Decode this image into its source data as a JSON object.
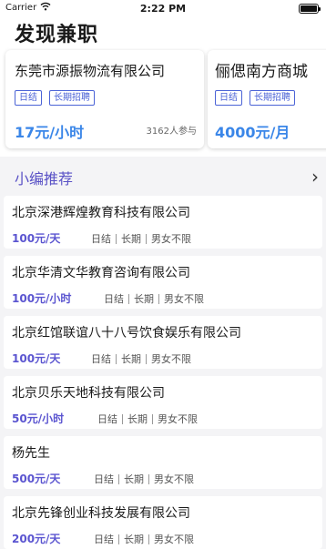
{
  "status_bar": {
    "carrier": "Carrier",
    "time": "2:22 PM"
  },
  "header": {
    "title": "发现兼职"
  },
  "featured": [
    {
      "company": "东莞市源振物流有限公司",
      "tags": [
        "日结",
        "长期招聘"
      ],
      "pay": "17元/小时",
      "participants": "3162人参与"
    },
    {
      "company": "俪偲南方商城",
      "tags": [
        "日结",
        "长期招聘"
      ],
      "pay": "4000元/月",
      "participants": ""
    }
  ],
  "section": {
    "title": "小编推荐",
    "arrow": "›"
  },
  "jobs": [
    {
      "company": "北京深港辉煌教育科技有限公司",
      "pay": "100元/天",
      "settle": "日结",
      "term": "长期",
      "gender": "男女不限"
    },
    {
      "company": "北京华清文华教育咨询有限公司",
      "pay": "100元/小时",
      "settle": "日结",
      "term": "长期",
      "gender": "男女不限"
    },
    {
      "company": "北京红馆联谊八十八号饮食娱乐有限公司",
      "pay": "100元/天",
      "settle": "日结",
      "term": "长期",
      "gender": "男女不限"
    },
    {
      "company": "北京贝乐天地科技有限公司",
      "pay": "50元/小时",
      "settle": "日结",
      "term": "长期",
      "gender": "男女不限"
    },
    {
      "company": "杨先生",
      "pay": "500元/天",
      "settle": "日结",
      "term": "长期",
      "gender": "男女不限"
    },
    {
      "company": "北京先锋创业科技发展有限公司",
      "pay": "200元/天",
      "settle": "日结",
      "term": "长期",
      "gender": "男女不限"
    }
  ]
}
